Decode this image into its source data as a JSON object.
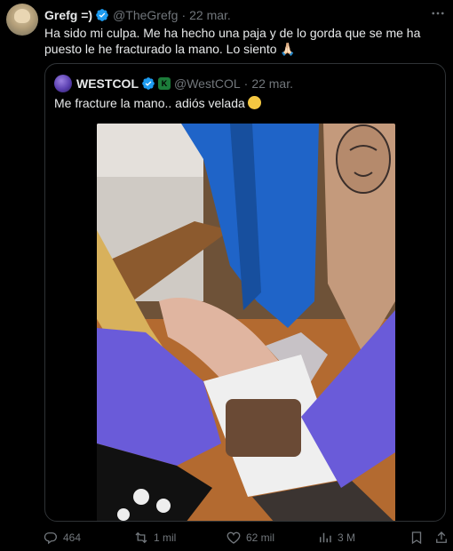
{
  "tweet": {
    "author_name": "Grefg =)",
    "handle": "@TheGrefg",
    "separator": "·",
    "date": "22 mar.",
    "more_icon": "more-icon",
    "text": "Ha sido mi culpa. Me ha hecho una paja y de lo gorda que se me ha puesto le he fracturado la mano. Lo siento 🙏🏻"
  },
  "quoted": {
    "author_name": "WESTCOL",
    "affiliate_badge": "K",
    "handle": "@WestCOL",
    "separator": "·",
    "date": "22 mar.",
    "text": "Me fracture la mano.. adiós velada",
    "emoji_icon": "relieved-face-icon"
  },
  "actions": {
    "replies": "464",
    "reposts": "1 mil",
    "likes": "62 mil",
    "views": "3 M"
  },
  "colors": {
    "background": "#000000",
    "text": "#e7e9ea",
    "muted": "#71767b",
    "verified": "#1d9bf0",
    "border": "#2f3336"
  }
}
